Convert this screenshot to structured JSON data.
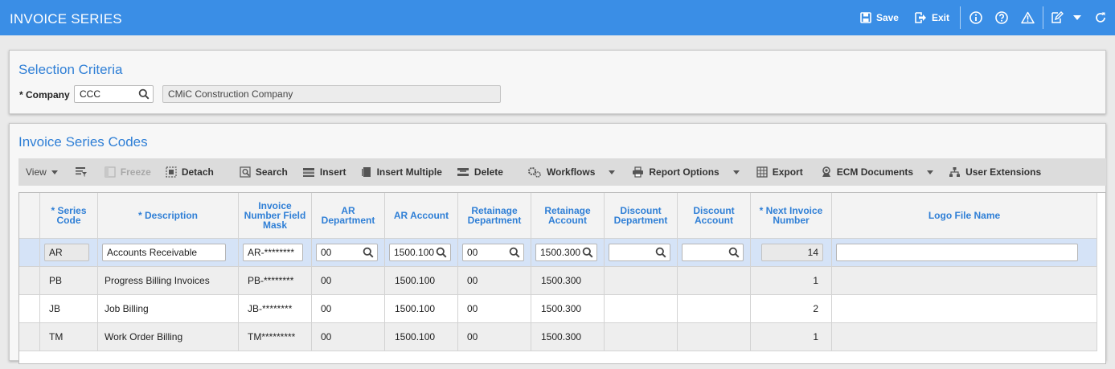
{
  "app": {
    "title": "INVOICE SERIES",
    "save_label": "Save",
    "exit_label": "Exit"
  },
  "selection": {
    "heading": "Selection Criteria",
    "company_label": "* Company",
    "company_code": "CCC",
    "company_name": "CMiC Construction Company"
  },
  "codes": {
    "heading": "Invoice Series Codes"
  },
  "toolbar": {
    "view": "View",
    "freeze": "Freeze",
    "detach": "Detach",
    "search": "Search",
    "insert": "Insert",
    "insert_multiple": "Insert Multiple",
    "delete": "Delete",
    "workflows": "Workflows",
    "report_options": "Report Options",
    "export": "Export",
    "ecm_documents": "ECM Documents",
    "user_extensions": "User Extensions"
  },
  "table": {
    "headers": {
      "series_code": "* Series Code",
      "description": "* Description",
      "mask": "Invoice Number Field Mask",
      "ar_dept": "AR Department",
      "ar_account": "AR Account",
      "ret_dept": "Retainage Department",
      "ret_account": "Retainage Account",
      "disc_dept": "Discount Department",
      "disc_account": "Discount Account",
      "next_num": "* Next Invoice Number",
      "logo": "Logo File Name"
    },
    "rows": [
      {
        "code": "AR",
        "description": "Accounts Receivable",
        "mask": "AR-********",
        "ar_dept": "00",
        "ar_account": "1500.100",
        "ret_dept": "00",
        "ret_account": "1500.300",
        "disc_dept": "",
        "disc_account": "",
        "next": "14",
        "logo": ""
      },
      {
        "code": "PB",
        "description": "Progress Billing Invoices",
        "mask": "PB-********",
        "ar_dept": "00",
        "ar_account": "1500.100",
        "ret_dept": "00",
        "ret_account": "1500.300",
        "disc_dept": "",
        "disc_account": "",
        "next": "1",
        "logo": ""
      },
      {
        "code": "JB",
        "description": "Job Billing",
        "mask": "JB-********",
        "ar_dept": "00",
        "ar_account": "1500.100",
        "ret_dept": "00",
        "ret_account": "1500.300",
        "disc_dept": "",
        "disc_account": "",
        "next": "2",
        "logo": ""
      },
      {
        "code": "TM",
        "description": "Work Order Billing",
        "mask": "TM*********",
        "ar_dept": "00",
        "ar_account": "1500.100",
        "ret_dept": "00",
        "ret_account": "1500.300",
        "disc_dept": "",
        "disc_account": "",
        "next": "1",
        "logo": ""
      }
    ]
  },
  "colors": {
    "title_bar": "#3a8ee6",
    "heading": "#2f7fd6",
    "selected_row": "#d5e3f7"
  }
}
